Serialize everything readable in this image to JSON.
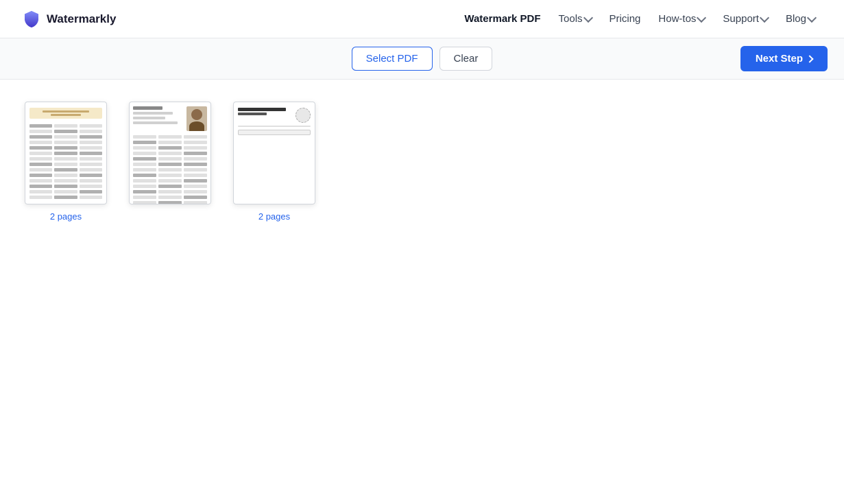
{
  "header": {
    "logo_text": "Watermarkly",
    "nav": [
      {
        "id": "watermark-pdf",
        "label": "Watermark PDF",
        "active": true,
        "has_dropdown": false
      },
      {
        "id": "tools",
        "label": "Tools",
        "active": false,
        "has_dropdown": true
      },
      {
        "id": "pricing",
        "label": "Pricing",
        "active": false,
        "has_dropdown": false
      },
      {
        "id": "how-tos",
        "label": "How-tos",
        "active": false,
        "has_dropdown": true
      },
      {
        "id": "support",
        "label": "Support",
        "active": false,
        "has_dropdown": true
      },
      {
        "id": "blog",
        "label": "Blog",
        "active": false,
        "has_dropdown": true
      }
    ]
  },
  "toolbar": {
    "select_pdf_label": "Select PDF",
    "clear_label": "Clear",
    "next_step_label": "Next Step"
  },
  "documents": [
    {
      "id": "doc1",
      "pages": "2 pages",
      "type": "resume"
    },
    {
      "id": "doc2",
      "pages": null,
      "type": "form-with-photo"
    },
    {
      "id": "doc3",
      "pages": "2 pages",
      "type": "checklist"
    }
  ]
}
